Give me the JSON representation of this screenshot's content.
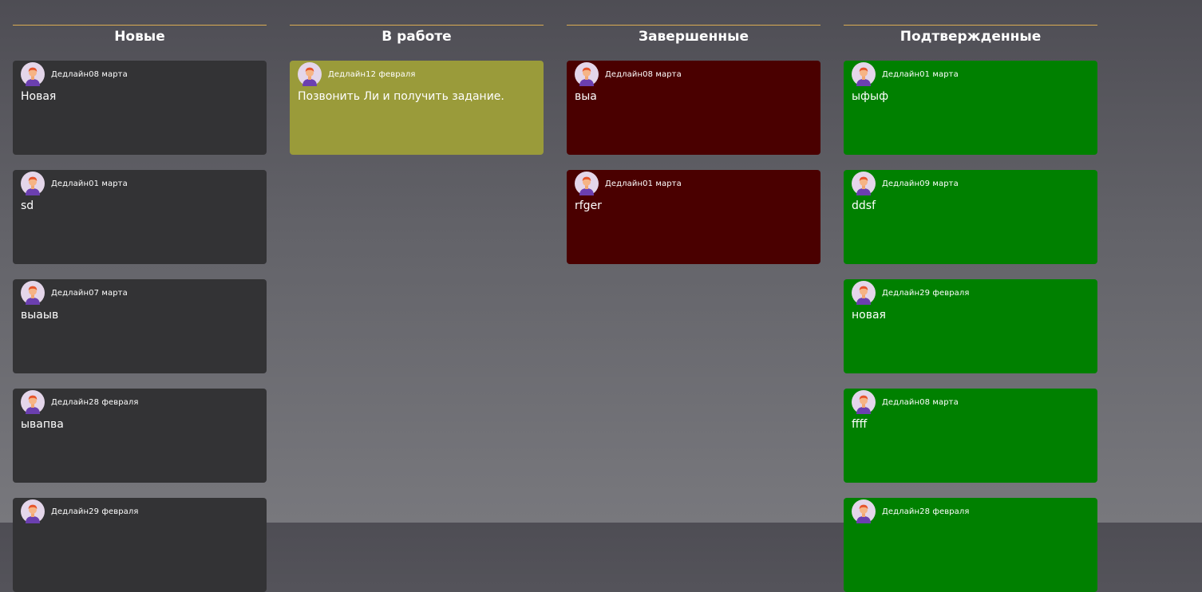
{
  "colors": {
    "header_rule": "#d9ac52",
    "new": "#333335",
    "in_progress": "#9a9b3a",
    "done": "#4a0000",
    "confirmed": "#008000"
  },
  "deadline_label": "Дедлайн",
  "columns": [
    {
      "title": "Новые",
      "color": "#333335",
      "cards": [
        {
          "date": "08 марта",
          "title": "Новая"
        },
        {
          "date": "01 марта",
          "title": "sd"
        },
        {
          "date": "07 марта",
          "title": "выаыв"
        },
        {
          "date": "28 февраля",
          "title": "ывапва"
        },
        {
          "date": "29 февраля",
          "title": ""
        }
      ]
    },
    {
      "title": "В работе",
      "color": "#9a9b3a",
      "cards": [
        {
          "date": "12 февраля",
          "title": "Позвонить Ли и получить задание."
        }
      ]
    },
    {
      "title": "Завершенные",
      "color": "#4a0000",
      "cards": [
        {
          "date": "08 марта",
          "title": "выа"
        },
        {
          "date": "01 марта",
          "title": "rfger"
        }
      ]
    },
    {
      "title": "Подтвержденные",
      "color": "#008000",
      "cards": [
        {
          "date": "01 марта",
          "title": "ыфыф"
        },
        {
          "date": "09 марта",
          "title": "ddsf"
        },
        {
          "date": "29 февраля",
          "title": "новая"
        },
        {
          "date": "08 марта",
          "title": "ffff"
        },
        {
          "date": "28 февраля",
          "title": ""
        }
      ]
    }
  ]
}
